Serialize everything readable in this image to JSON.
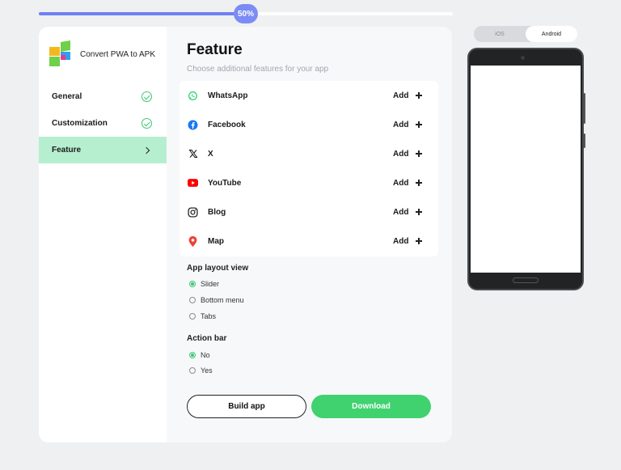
{
  "progress": {
    "label": "50%",
    "value": 0.5
  },
  "brand": {
    "name": "Convert PWA to APK"
  },
  "nav": [
    {
      "label": "General",
      "state": "done"
    },
    {
      "label": "Customization",
      "state": "done"
    },
    {
      "label": "Feature",
      "state": "active"
    }
  ],
  "page": {
    "title": "Feature",
    "subtitle": "Choose additional features for your app"
  },
  "features": [
    {
      "name": "WhatsApp",
      "icon": "whatsapp-icon",
      "color": "#25d366",
      "add": "Add"
    },
    {
      "name": "Facebook",
      "icon": "facebook-icon",
      "color": "#1877f2",
      "add": "Add"
    },
    {
      "name": "X",
      "icon": "x-icon",
      "color": "#111111",
      "add": "Add"
    },
    {
      "name": "YouTube",
      "icon": "youtube-icon",
      "color": "#ff0000",
      "add": "Add"
    },
    {
      "name": "Blog",
      "icon": "instagram-icon",
      "color": "#111111",
      "add": "Add"
    },
    {
      "name": "Map",
      "icon": "map-pin-icon",
      "color": "#ea4335",
      "add": "Add"
    }
  ],
  "layout_view": {
    "label": "App layout view",
    "options": [
      "Slider",
      "Bottom menu",
      "Tabs"
    ],
    "selected": "Slider"
  },
  "action_bar": {
    "label": "Action bar",
    "options": [
      "No",
      "Yes"
    ],
    "selected": "No"
  },
  "buttons": {
    "build": "Build app",
    "download": "Download"
  },
  "platform": {
    "options": [
      "iOS",
      "Android"
    ],
    "selected": "Android"
  },
  "colors": {
    "accent": "#3fd26f",
    "progress": "#6f80f3",
    "active_nav": "#b6efd0"
  }
}
